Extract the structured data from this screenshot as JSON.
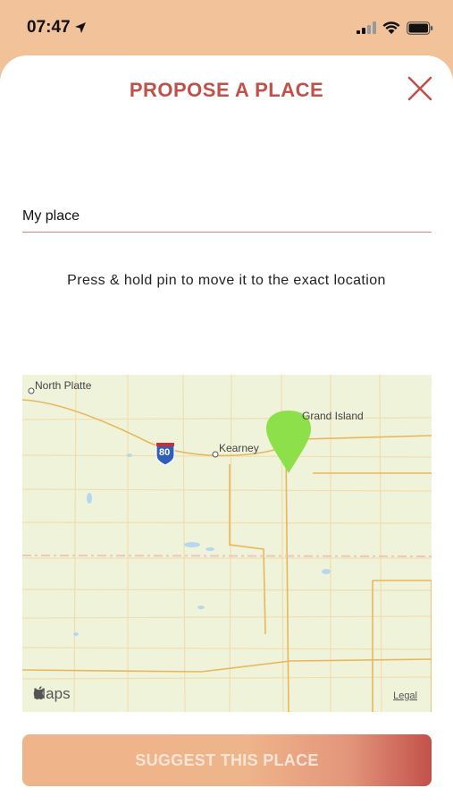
{
  "status": {
    "time": "07:47"
  },
  "header": {
    "title": "PROPOSE A PLACE"
  },
  "form": {
    "place_name_value": "My place",
    "hint": "Press & hold pin to move it to the exact location"
  },
  "map": {
    "labels": {
      "north_platte": "North Platte",
      "kearney": "Kearney",
      "grand_island": "Grand Island",
      "interstate": "80"
    },
    "brand": "Maps",
    "legal": "Legal",
    "pin_color": "#8ee04a"
  },
  "actions": {
    "suggest_label": "SUGGEST THIS PLACE"
  },
  "colors": {
    "accent": "#c0504a",
    "background": "#f2c29a"
  }
}
